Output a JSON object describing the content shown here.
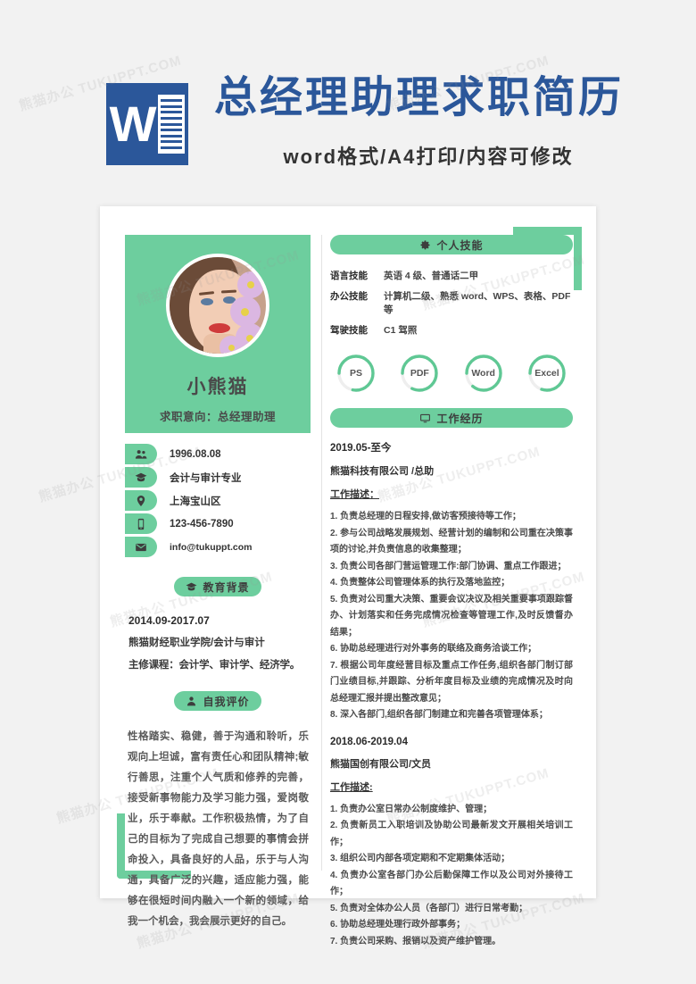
{
  "banner": {
    "logo_letter": "W",
    "title": "总经理助理求职简历",
    "subtitle": "word格式/A4打印/内容可修改",
    "brand_color": "#2b579a"
  },
  "theme": {
    "accent": "#6dce9e",
    "page_bg": "#f2f2f2",
    "sheet_bg": "#ffffff"
  },
  "resume": {
    "profile": {
      "name": "小熊猫",
      "objective": "求职意向：总经理助理"
    },
    "contacts": [
      {
        "icon": "people-icon",
        "value": "1996.08.08"
      },
      {
        "icon": "graduation-cap-icon",
        "value": "会计与审计专业"
      },
      {
        "icon": "location-pin-icon",
        "value": "上海宝山区"
      },
      {
        "icon": "phone-icon",
        "value": "123-456-7890"
      },
      {
        "icon": "envelope-icon",
        "value": "info@tukuppt.com"
      }
    ],
    "education": {
      "heading": "教育背景",
      "heading_icon": "graduation-cap-icon",
      "date": "2014.09-2017.07",
      "school": "熊猫财经职业学院/会计与审计",
      "courses": "主修课程：会计学、审计学、经济学。"
    },
    "self_evaluation": {
      "heading": "自我评价",
      "heading_icon": "person-icon",
      "text": "性格踏实、稳健，善于沟通和聆听，乐观向上坦诚，富有责任心和团队精神;敏行善思，注重个人气质和修养的完善，接受新事物能力及学习能力强，爱岗敬业，乐于奉献。工作积极热情，为了自己的目标为了完成自己想要的事情会拼命投入，具备良好的人品，乐于与人沟通，具备广泛的兴趣，适应能力强，能够在很短时间内融入一个新的领域，给我一个机会，我会展示更好的自己。"
    },
    "skills": {
      "heading": "个人技能",
      "heading_icon": "gear-icon",
      "rows": [
        {
          "key": "语言技能",
          "value": "英语 4 级、普通话二甲"
        },
        {
          "key": "办公技能",
          "value": "计算机二级、熟悉 word、WPS、表格、PDF 等"
        },
        {
          "key": "驾驶技能",
          "value": "C1 驾照"
        }
      ],
      "rings": [
        {
          "label": "PS",
          "percent": 78
        },
        {
          "label": "PDF",
          "percent": 82
        },
        {
          "label": "Word",
          "percent": 86
        },
        {
          "label": "Excel",
          "percent": 80
        }
      ]
    },
    "experience": {
      "heading": "工作经历",
      "heading_icon": "monitor-icon",
      "jobs": [
        {
          "date": "2019.05-至今",
          "org": "熊猫科技有限公司 /总助",
          "desc_label": "工作描述：",
          "items": [
            "1. 负责总经理的日程安排,做访客预接待等工作；",
            "2. 参与公司战略发展规划、经营计划的编制和公司重在决策事项的讨论,并负责信息的收集整理；",
            "3. 负责公司各部门营运管理工作:部门协调、重点工作跟进；",
            "4. 负责整体公司管理体系的执行及落地监控；",
            "5. 负责对公司重大决策、重要会议决议及相关重要事项跟踪督办、计划落实和任务完成情况检查等管理工作,及时反馈督办结果；",
            "6. 协助总经理进行对外事务的联络及商务洽谈工作；",
            "7. 根据公司年度经营目标及重点工作任务,组织各部门制订部门业绩目标,并跟踪、分析年度目标及业绩的完成情况及时向总经理汇报并提出整改意见；",
            "8. 深入各部门,组织各部门制建立和完善各项管理体系；"
          ]
        },
        {
          "date": "2018.06-2019.04",
          "org": "熊猫国创有限公司/文员",
          "desc_label": "工作描述:",
          "items": [
            "1. 负责办公室日常办公制度维护、管理；",
            "2. 负责新员工入职培训及协助公司最新发文开展相关培训工作；",
            "3. 组织公司内部各项定期和不定期集体活动；",
            "4. 负责办公室各部门办公后勤保障工作以及公司对外接待工作；",
            "5. 负责对全体办公人员（各部门）进行日常考勤；",
            "6. 协助总经理处理行政外部事务；",
            "7. 负责公司采购、报销以及资产维护管理。"
          ]
        }
      ]
    }
  },
  "watermarks": [
    "熊猫办公 TUKUPPT.COM",
    "熊猫办公 TUKUPPT.COM",
    "熊猫办公 TUKUPPT.COM",
    "熊猫办公 TUKUPPT.COM",
    "熊猫办公 TUKUPPT.COM",
    "熊猫办公 TUKUPPT.COM",
    "熊猫办公 TUKUPPT.COM",
    "熊猫办公 TUKUPPT.COM",
    "熊猫办公 TUKUPPT.COM",
    "熊猫办公 TUKUPPT.COM",
    "熊猫办公 TUKUPPT.COM",
    "熊猫办公 TUKUPPT.COM"
  ]
}
